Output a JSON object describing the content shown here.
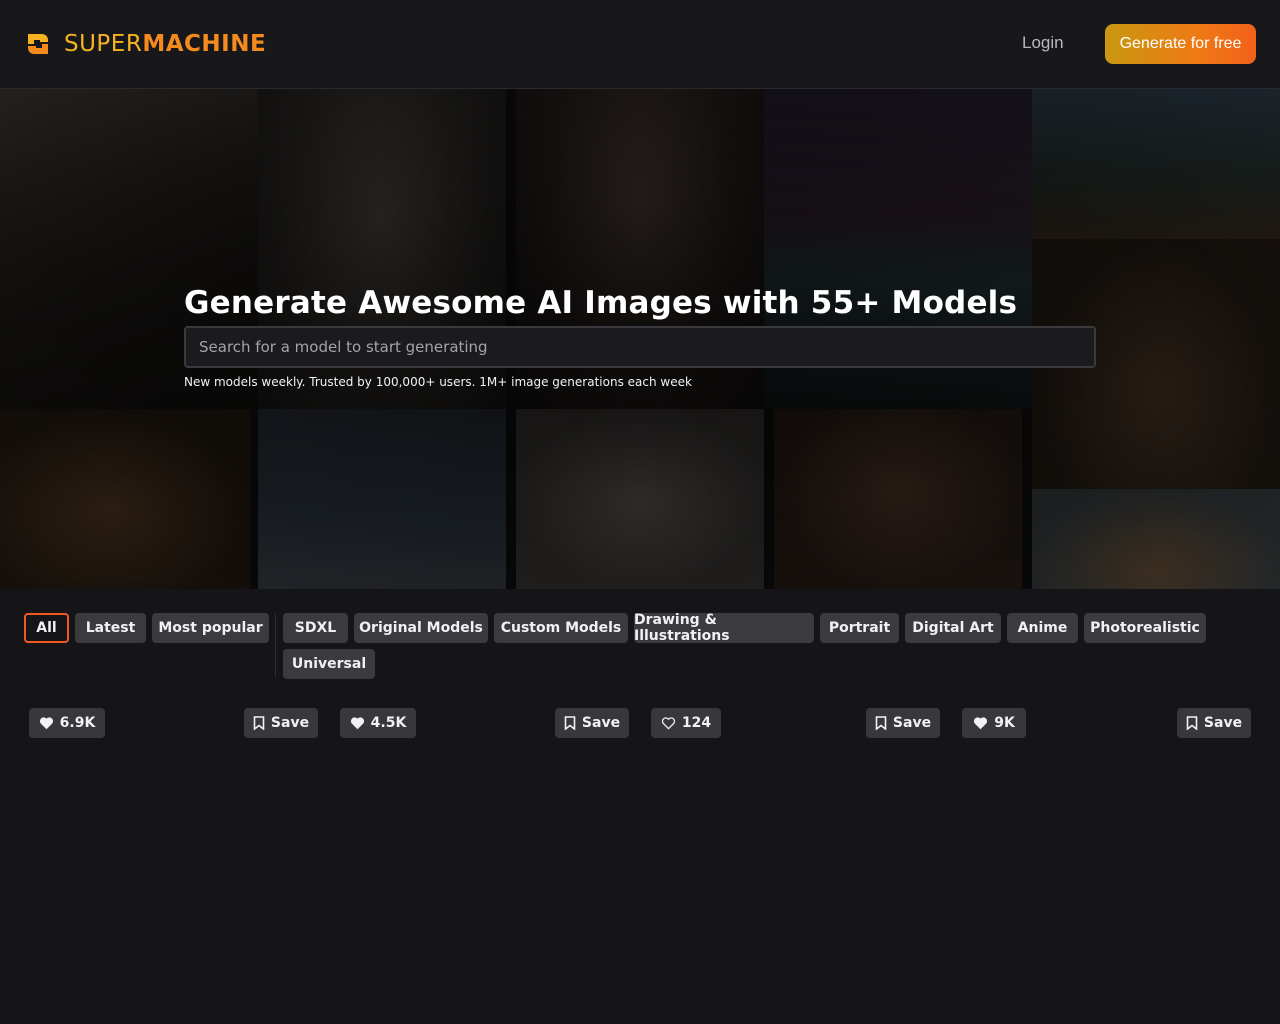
{
  "brand": {
    "name_part1": "SUPER",
    "name_part2": "MACHINE",
    "colors": {
      "yellow": "#f6b221",
      "orange": "#f58a1f"
    }
  },
  "header": {
    "login_label": "Login",
    "cta_label": "Generate for free"
  },
  "hero": {
    "title": "Generate Awesome AI Images with 55+ Models",
    "search_placeholder": "Search for a model to start generating",
    "subtitle": "New models weekly. Trusted by 100,000+ users. 1M+ image generations each week"
  },
  "filters": {
    "primary": [
      "All",
      "Latest",
      "Most popular"
    ],
    "categories": [
      "SDXL",
      "Original Models",
      "Custom Models",
      "Drawing & Illustrations",
      "Portrait",
      "Digital Art",
      "Anime",
      "Photorealistic",
      "Universal"
    ],
    "active": "All",
    "active_color": "#ef5a24"
  },
  "cards": [
    {
      "likes": "6.9K",
      "liked": true,
      "save_label": "Save"
    },
    {
      "likes": "4.5K",
      "liked": true,
      "save_label": "Save"
    },
    {
      "likes": "124",
      "liked": false,
      "save_label": "Save"
    },
    {
      "likes": "9K",
      "liked": true,
      "save_label": "Save"
    }
  ],
  "icons": {
    "like": "heart-icon",
    "save": "bookmark-icon"
  }
}
